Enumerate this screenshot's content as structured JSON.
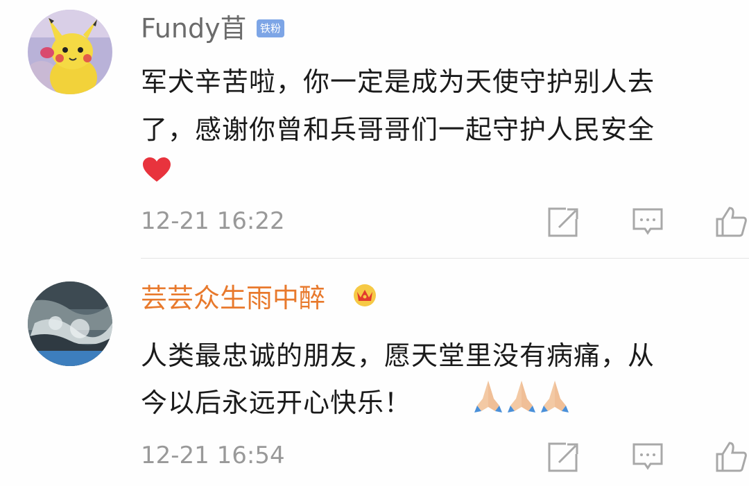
{
  "comments": [
    {
      "username": "Fundy苜",
      "badge": "铁粉",
      "line1": "军犬辛苦啦，你一定是成为天使守护别人去",
      "line2": "了，感谢你曾和兵哥哥们一起守护人民安全",
      "emoji": "heart",
      "timestamp": "12-21 16:22"
    },
    {
      "username": "芸芸众生雨中醉",
      "badge_icon": "crown",
      "line1": "人类最忠诚的朋友，愿天堂里没有病痛，从",
      "line2": "今以后永远开心快乐！",
      "emoji": "folded-hands",
      "emoji_count": 3,
      "timestamp": "12-21 16:54"
    }
  ],
  "colors": {
    "username_default": "#6b6b6b",
    "username_vip": "#e8792c",
    "badge_bg": "#7da5e6",
    "timestamp": "#999999",
    "text": "#1a1a1a",
    "icon": "#a8a8a8"
  },
  "icons": [
    "share-icon",
    "comment-icon",
    "like-icon"
  ]
}
